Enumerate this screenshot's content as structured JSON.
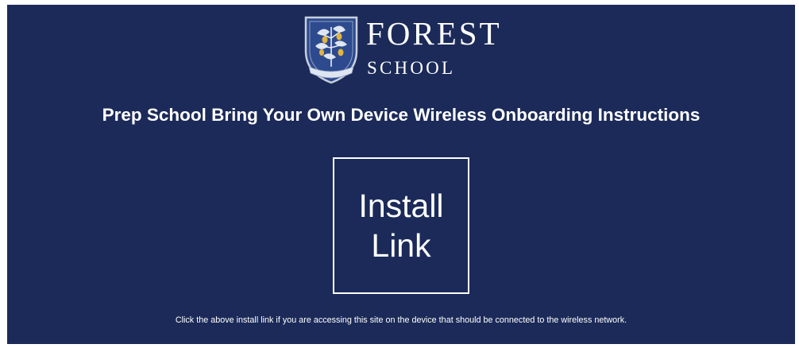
{
  "colors": {
    "background": "#1b2a58",
    "text": "#ffffff",
    "crest_gold": "#e0b640",
    "crest_blue": "#2e4a8e"
  },
  "logo": {
    "icon": "school-crest-icon",
    "word_top": "FOREST",
    "word_bottom": "SCHOOL"
  },
  "heading": "Prep School Bring Your Own Device Wireless Onboarding Instructions",
  "install_link": {
    "label": "Install Link"
  },
  "instruction_text": "Click the above install link if you are accessing this site on the device that should be connected to the wireless network."
}
